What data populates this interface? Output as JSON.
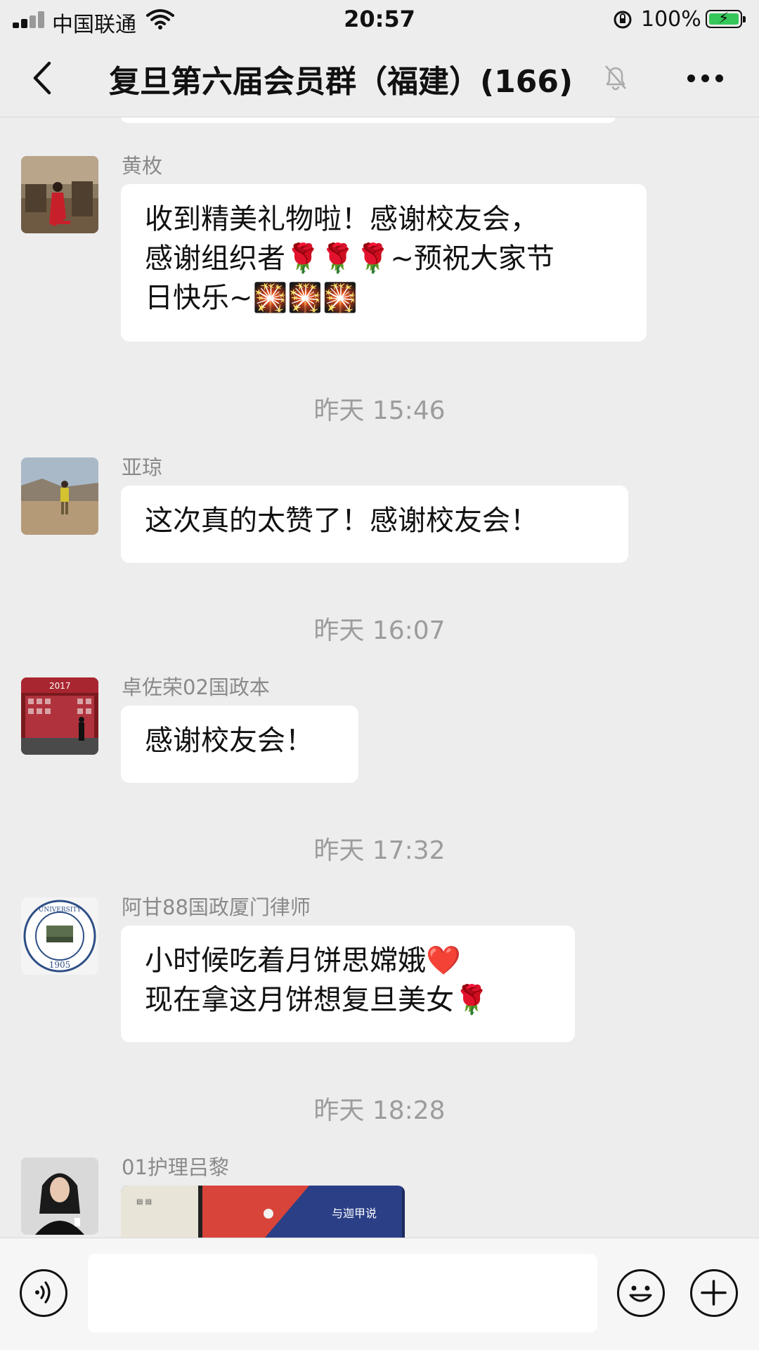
{
  "status_bar": {
    "carrier": "中国联通",
    "time": "20:57",
    "battery": "100%",
    "icons": [
      "signal-icon",
      "wifi-icon",
      "orientation-lock-icon",
      "battery-charging-icon"
    ]
  },
  "header": {
    "title": "复旦第六届会员群（福建）(166)",
    "icons": [
      "back-chevron-icon",
      "mute-bell-icon",
      "more-dots-icon"
    ]
  },
  "messages": [
    {
      "sender": "黄枚",
      "lines": [
        "收到精美礼物啦！感谢校友会，",
        "感谢组织者🌹🌹🌹~预祝大家节",
        "日快乐~🎇🎇🎇"
      ]
    },
    {
      "timestamp": "昨天 15:46"
    },
    {
      "sender": "亚琼",
      "lines": [
        "这次真的太赞了！感谢校友会！"
      ]
    },
    {
      "timestamp": "昨天 16:07"
    },
    {
      "sender": "卓佐荣02国政本",
      "lines": [
        "感谢校友会！"
      ]
    },
    {
      "timestamp": "昨天 17:32"
    },
    {
      "sender": "阿甘88国政厦门律师",
      "lines": [
        "小时候吃着月饼思嫦娥❤️",
        "现在拿这月饼想复旦美女🌹"
      ]
    },
    {
      "timestamp": "昨天 18:28"
    },
    {
      "sender": "01护理吕黎",
      "image_caption": "与迦甲说"
    }
  ],
  "input_bar": {
    "placeholder": "",
    "icons": [
      "voice-icon",
      "emoji-icon",
      "plus-icon"
    ]
  },
  "colors": {
    "background": "#ededed",
    "bubble": "#ffffff",
    "timestamp": "#9c9c9c",
    "sender": "#8a8a8a",
    "battery_fill": "#35c759"
  }
}
